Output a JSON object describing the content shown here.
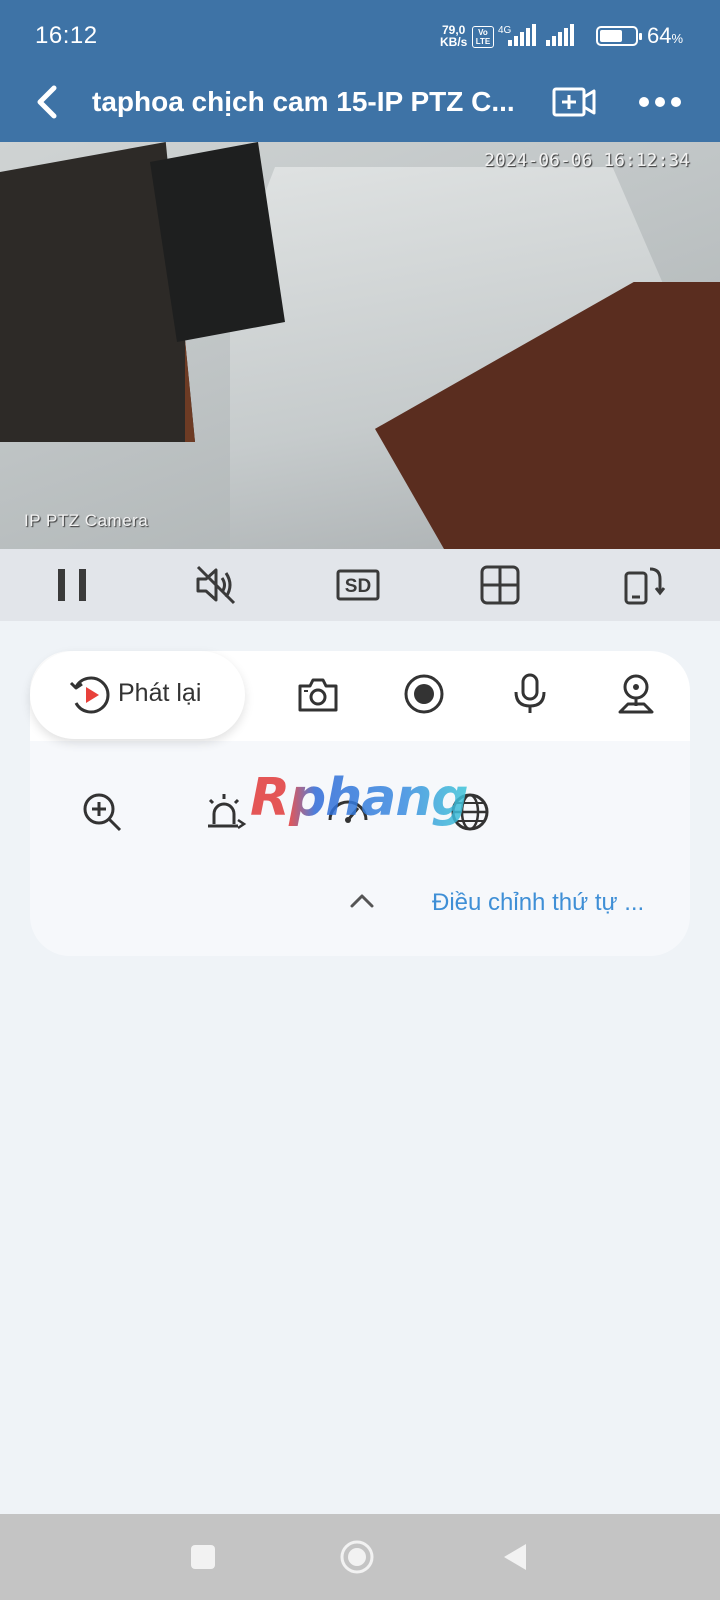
{
  "status_bar": {
    "time": "16:12",
    "net_speed_value": "79,0",
    "net_speed_unit": "KB/s",
    "volte": "Vo LTE",
    "network_type": "4G",
    "battery_percent": "64",
    "battery_unit": "%",
    "battery_level": 0.64
  },
  "header": {
    "title": "taphoa chịch cam 15-IP PTZ C...",
    "back_icon": "chevron-left-icon",
    "add_camera_icon": "video-add-icon",
    "more_icon": "more-dots-icon"
  },
  "video": {
    "timestamp": "2024-06-06 16:12:34",
    "camera_name": "IP PTZ Camera"
  },
  "controls": {
    "items": [
      "pause-icon",
      "mute-icon",
      "sd-quality-icon",
      "grid-view-icon",
      "rotate-screen-icon"
    ],
    "sd_label": "SD"
  },
  "actions": {
    "playback_label": "Phát lại",
    "items": [
      "camera-snapshot-icon",
      "record-icon",
      "microphone-icon",
      "ptz-person-icon"
    ]
  },
  "tools": {
    "items": [
      "zoom-in-icon",
      "alarm-siren-icon",
      "speed-gauge-icon",
      "globe-icon"
    ],
    "adjust_order_label": "Điều chỉnh thứ tự ..."
  },
  "watermark": "Rphang",
  "colors": {
    "header_bg": "#3e73a6",
    "accent_blue": "#3f8fd6",
    "playback_red": "#e8413b",
    "page_bg": "#eff3f7"
  }
}
